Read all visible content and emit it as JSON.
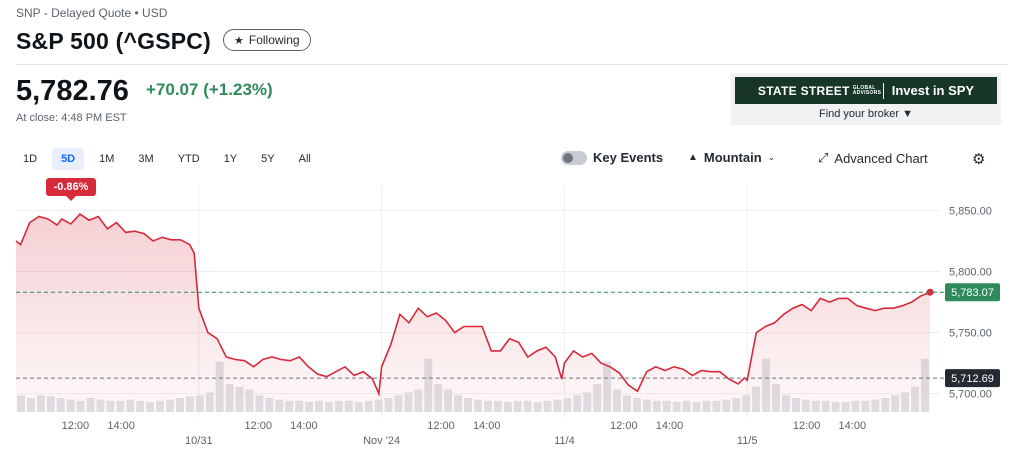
{
  "header": {
    "meta": "SNP - Delayed Quote • USD",
    "title": "S&P 500 (^GSPC)",
    "follow_label": "Following",
    "price": "5,782.76",
    "change": "+70.07",
    "change_pct": "(+1.23%)",
    "close_time": "At close: 4:48 PM EST"
  },
  "ad": {
    "brand": "STATE STREET",
    "brand_sub": "GLOBAL ADVISORS",
    "cta": "Invest in SPY",
    "sub": "Find your broker"
  },
  "ranges": [
    "1D",
    "5D",
    "1M",
    "3M",
    "YTD",
    "1Y",
    "5Y",
    "All"
  ],
  "active_range": "5D",
  "toolbar": {
    "key_events": "Key Events",
    "chart_type": "Mountain",
    "advanced": "Advanced Chart"
  },
  "colors": {
    "down": "#d6293a",
    "up": "#2f8a5b",
    "active": "#0f69ff"
  },
  "chart_data": {
    "type": "area",
    "y_ticks": [
      "5,850.00",
      "5,800.00",
      "5,750.00",
      "5,700.00"
    ],
    "y_tick_values": [
      5850,
      5800,
      5750,
      5700
    ],
    "ylim": [
      5685,
      5870
    ],
    "x_tick_labels": [
      "12:00",
      "14:00",
      "10/31",
      "12:00",
      "14:00",
      "Nov '24",
      "12:00",
      "14:00",
      "11/4",
      "12:00",
      "14:00",
      "11/5",
      "12:00",
      "14:00"
    ],
    "x_tick_positions": [
      0.65,
      1.15,
      2.0,
      2.65,
      3.15,
      4.0,
      4.65,
      5.15,
      6.0,
      6.65,
      7.15,
      8.0,
      8.65,
      9.15
    ],
    "x_range": [
      0,
      10
    ],
    "change_badge": "-0.86%",
    "current_value": 5783.07,
    "current_label": "5,783.07",
    "prev_close_value": 5712.69,
    "prev_close_label": "5,712.69",
    "series": [
      {
        "x": [
          0,
          0.05,
          0.15,
          0.25,
          0.35,
          0.45,
          0.5,
          0.6,
          0.7,
          0.8,
          0.9,
          1.0,
          1.1,
          1.2,
          1.3,
          1.4,
          1.5,
          1.6,
          1.7,
          1.8,
          1.9,
          1.95,
          2.0,
          2.1,
          2.2,
          2.3,
          2.4,
          2.5,
          2.6,
          2.7,
          2.8,
          2.9,
          3.0,
          3.1,
          3.2,
          3.3,
          3.4,
          3.5,
          3.6,
          3.7,
          3.8,
          3.9,
          3.97,
          4.0,
          4.1,
          4.2,
          4.3,
          4.4,
          4.5,
          4.6,
          4.7,
          4.8,
          4.9,
          5.0,
          5.1,
          5.2,
          5.3,
          5.4,
          5.5,
          5.6,
          5.7,
          5.8,
          5.9,
          5.97,
          6.0,
          6.1,
          6.2,
          6.3,
          6.4,
          6.5,
          6.6,
          6.7,
          6.8,
          6.9,
          7.0,
          7.1,
          7.2,
          7.3,
          7.4,
          7.5,
          7.6,
          7.7,
          7.8,
          7.9,
          7.97,
          8.0,
          8.1,
          8.2,
          8.3,
          8.4,
          8.5,
          8.6,
          8.7,
          8.8,
          8.9,
          9.0,
          9.1,
          9.2,
          9.3,
          9.4,
          9.5,
          9.6,
          9.7,
          9.8,
          9.9,
          10.0
        ],
        "values": [
          5825,
          5822,
          5840,
          5845,
          5843,
          5838,
          5843,
          5839,
          5847,
          5842,
          5845,
          5835,
          5840,
          5832,
          5833,
          5831,
          5825,
          5828,
          5826,
          5826,
          5822,
          5815,
          5770,
          5750,
          5745,
          5730,
          5728,
          5727,
          5722,
          5728,
          5730,
          5728,
          5727,
          5730,
          5722,
          5716,
          5714,
          5718,
          5722,
          5715,
          5718,
          5712,
          5700,
          5722,
          5740,
          5765,
          5758,
          5770,
          5763,
          5766,
          5760,
          5750,
          5755,
          5755,
          5755,
          5735,
          5735,
          5745,
          5742,
          5730,
          5735,
          5738,
          5730,
          5712,
          5725,
          5735,
          5730,
          5733,
          5725,
          5722,
          5717,
          5707,
          5702,
          5718,
          5722,
          5719,
          5722,
          5720,
          5715,
          5719,
          5718,
          5718,
          5712,
          5708,
          5713,
          5711,
          5750,
          5755,
          5758,
          5765,
          5770,
          5773,
          5768,
          5778,
          5775,
          5778,
          5778,
          5772,
          5770,
          5768,
          5770,
          5770,
          5772,
          5775,
          5780,
          5783.07
        ]
      }
    ],
    "volume": [
      0.3,
      0.25,
      0.3,
      0.28,
      0.25,
      0.22,
      0.2,
      0.25,
      0.22,
      0.2,
      0.2,
      0.22,
      0.2,
      0.18,
      0.2,
      0.22,
      0.25,
      0.28,
      0.3,
      0.35,
      0.9,
      0.5,
      0.45,
      0.4,
      0.3,
      0.25,
      0.22,
      0.2,
      0.2,
      0.18,
      0.2,
      0.18,
      0.2,
      0.2,
      0.18,
      0.2,
      0.22,
      0.25,
      0.3,
      0.35,
      0.4,
      0.95,
      0.5,
      0.4,
      0.3,
      0.25,
      0.22,
      0.2,
      0.2,
      0.18,
      0.2,
      0.2,
      0.18,
      0.2,
      0.22,
      0.25,
      0.3,
      0.35,
      0.5,
      0.9,
      0.4,
      0.3,
      0.25,
      0.22,
      0.2,
      0.2,
      0.18,
      0.2,
      0.18,
      0.2,
      0.2,
      0.22,
      0.25,
      0.3,
      0.45,
      0.95,
      0.5,
      0.3,
      0.25,
      0.22,
      0.2,
      0.2,
      0.18,
      0.18,
      0.2,
      0.2,
      0.22,
      0.25,
      0.3,
      0.35,
      0.45,
      0.95
    ]
  }
}
